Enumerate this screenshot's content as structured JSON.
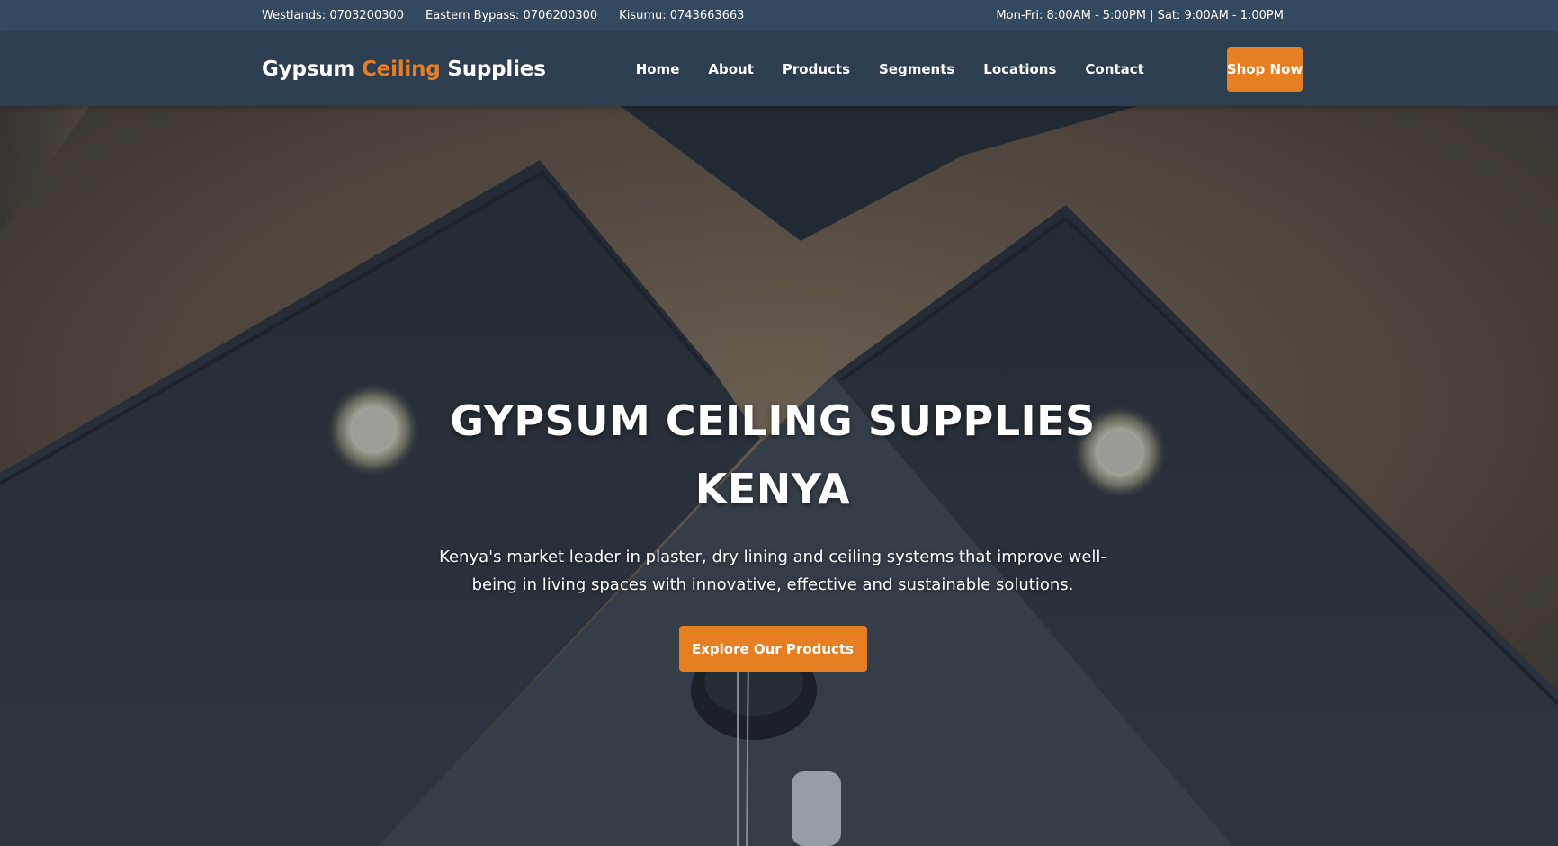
{
  "topbar": {
    "phones": [
      {
        "label": "Westlands: 0703200300"
      },
      {
        "label": "Eastern Bypass: 0706200300"
      },
      {
        "label": "Kisumu: 0743663663"
      }
    ],
    "hours": "Mon-Fri: 8:00AM - 5:00PM | Sat: 9:00AM - 1:00PM"
  },
  "header": {
    "logo": {
      "part1": "Gypsum ",
      "accent": "Ceiling",
      "part2": " Supplies"
    },
    "nav": [
      {
        "label": "Home"
      },
      {
        "label": "About"
      },
      {
        "label": "Products"
      },
      {
        "label": "Segments"
      },
      {
        "label": "Locations"
      },
      {
        "label": "Contact"
      }
    ],
    "cta": "Shop Now"
  },
  "hero": {
    "title": "GYPSUM CEILING SUPPLIES KENYA",
    "text": "Kenya's market leader in plaster, dry lining and ceiling systems that improve well-being in living spaces with innovative, effective and sustainable solutions.",
    "cta": "Explore Our Products",
    "background": "gypsum-ceiling-photo"
  },
  "colors": {
    "accent": "#e67e22",
    "header_bg": "#2c3e50",
    "topbar_bg": "#34485f"
  }
}
